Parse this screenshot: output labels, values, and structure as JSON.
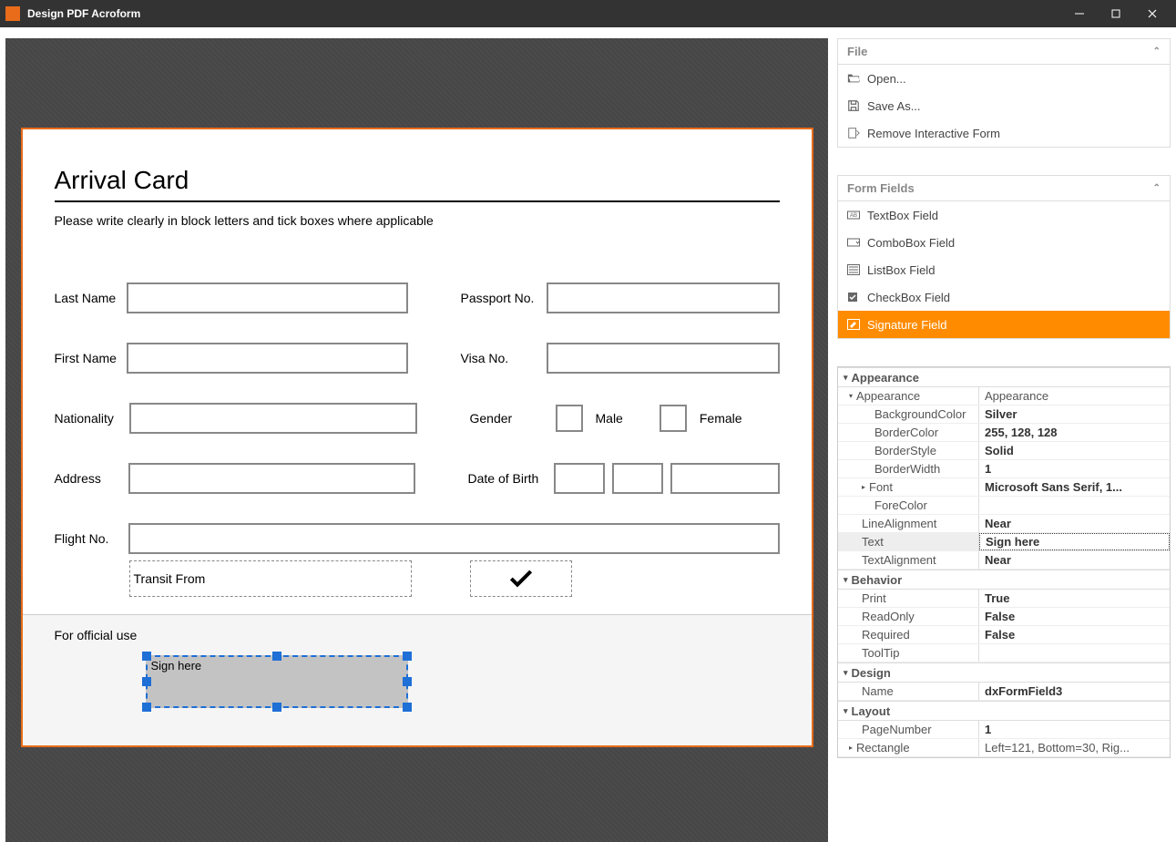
{
  "window": {
    "title": "Design PDF Acroform"
  },
  "form": {
    "title": "Arrival Card",
    "instruction": "Please write clearly in block letters and tick boxes where applicable",
    "labels": {
      "lastName": "Last Name",
      "firstName": "First Name",
      "nationality": "Nationality",
      "address": "Address",
      "flightNo": "Flight No.",
      "passportNo": "Passport No.",
      "visaNo": "Visa No.",
      "gender": "Gender",
      "male": "Male",
      "female": "Female",
      "dob": "Date of Birth",
      "transit": "Transit  From",
      "official": "For official use"
    },
    "selectedFieldText": "Sign here"
  },
  "sidebar": {
    "file": {
      "header": "File",
      "open": "Open...",
      "saveAs": "Save As...",
      "remove": "Remove Interactive Form"
    },
    "fields": {
      "header": "Form Fields",
      "textbox": "TextBox Field",
      "combobox": "ComboBox Field",
      "listbox": "ListBox Field",
      "checkbox": "CheckBox Field",
      "signature": "Signature Field"
    }
  },
  "props": {
    "sections": {
      "appearance": "Appearance",
      "behavior": "Behavior",
      "design": "Design",
      "layout": "Layout"
    },
    "appearance": {
      "AppearanceLabel": "Appearance",
      "AppearanceValue": "Appearance",
      "BackgroundColor": "Silver",
      "BorderColor": "255, 128, 128",
      "BorderStyle": "Solid",
      "BorderWidth": "1",
      "Font": "Microsoft Sans Serif, 1...",
      "ForeColor": "",
      "LineAlignment": "Near",
      "Text": "Sign here",
      "TextAlignment": "Near"
    },
    "behavior": {
      "Print": "True",
      "ReadOnly": "False",
      "Required": "False",
      "ToolTip": ""
    },
    "design": {
      "Name": "dxFormField3"
    },
    "layout": {
      "PageNumber": "1",
      "Rectangle": "Left=121, Bottom=30, Rig..."
    },
    "keys": {
      "BackgroundColor": "BackgroundColor",
      "BorderColor": "BorderColor",
      "BorderStyle": "BorderStyle",
      "BorderWidth": "BorderWidth",
      "Font": "Font",
      "ForeColor": "ForeColor",
      "LineAlignment": "LineAlignment",
      "Text": "Text",
      "TextAlignment": "TextAlignment",
      "Print": "Print",
      "ReadOnly": "ReadOnly",
      "Required": "Required",
      "ToolTip": "ToolTip",
      "Name": "Name",
      "PageNumber": "PageNumber",
      "Rectangle": "Rectangle"
    }
  }
}
